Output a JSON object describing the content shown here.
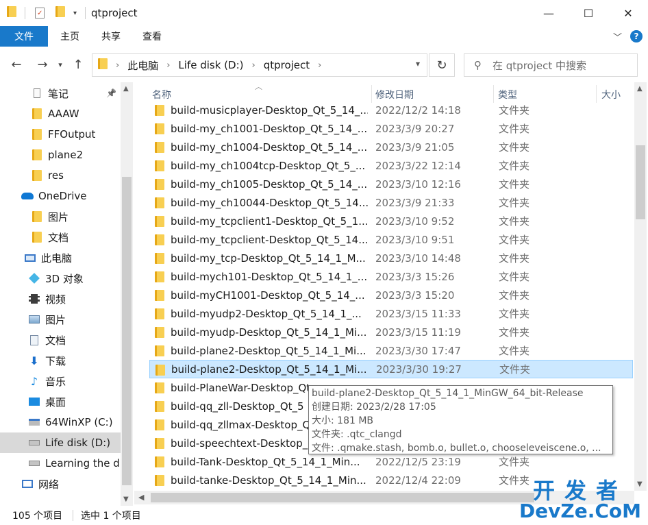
{
  "window": {
    "title": "qtproject",
    "minimize": "—",
    "maximize": "☐",
    "close": "✕"
  },
  "ribbon": {
    "tabs": [
      "文件",
      "主页",
      "共享",
      "查看"
    ]
  },
  "address": {
    "crumbs": [
      "此电脑",
      "Life disk (D:)",
      "qtproject"
    ],
    "search_placeholder": "在 qtproject 中搜索"
  },
  "nav": {
    "items": [
      {
        "label": "笔记",
        "icon": "notes-icon",
        "pinned": true
      },
      {
        "label": "AAAW",
        "icon": "folder-icon"
      },
      {
        "label": "FFOutput",
        "icon": "folder-icon"
      },
      {
        "label": "plane2",
        "icon": "folder-icon"
      },
      {
        "label": "res",
        "icon": "folder-icon"
      },
      {
        "label": "OneDrive",
        "icon": "onedrive-icon"
      },
      {
        "label": "图片",
        "icon": "folder-icon"
      },
      {
        "label": "文档",
        "icon": "folder-icon"
      },
      {
        "label": "此电脑",
        "icon": "computer-icon"
      },
      {
        "label": "3D 对象",
        "icon": "3d-objects-icon"
      },
      {
        "label": "视频",
        "icon": "video-icon"
      },
      {
        "label": "图片",
        "icon": "pictures-icon"
      },
      {
        "label": "文档",
        "icon": "documents-icon"
      },
      {
        "label": "下载",
        "icon": "download-icon"
      },
      {
        "label": "音乐",
        "icon": "music-icon"
      },
      {
        "label": "桌面",
        "icon": "desktop-icon"
      },
      {
        "label": "64WinXP  (C:)",
        "icon": "windows-drive-icon"
      },
      {
        "label": "Life disk (D:)",
        "icon": "drive-icon",
        "selected": true
      },
      {
        "label": "Learning the di",
        "icon": "drive-icon"
      },
      {
        "label": "网络",
        "icon": "network-icon"
      }
    ]
  },
  "columns": {
    "name": "名称",
    "date": "修改日期",
    "type": "类型",
    "size": "大小"
  },
  "files": [
    {
      "name": "build-musicplayer-Desktop_Qt_5_14_...",
      "date": "2022/12/2 14:18",
      "type": "文件夹"
    },
    {
      "name": "build-my_ch1001-Desktop_Qt_5_14_...",
      "date": "2023/3/9 20:27",
      "type": "文件夹"
    },
    {
      "name": "build-my_ch1004-Desktop_Qt_5_14_...",
      "date": "2023/3/9 21:05",
      "type": "文件夹"
    },
    {
      "name": "build-my_ch1004tcp-Desktop_Qt_5_...",
      "date": "2023/3/22 12:14",
      "type": "文件夹"
    },
    {
      "name": "build-my_ch1005-Desktop_Qt_5_14_...",
      "date": "2023/3/10 12:16",
      "type": "文件夹"
    },
    {
      "name": "build-my_ch10044-Desktop_Qt_5_14...",
      "date": "2023/3/9 21:33",
      "type": "文件夹"
    },
    {
      "name": "build-my_tcpclient1-Desktop_Qt_5_1...",
      "date": "2023/3/10 9:52",
      "type": "文件夹"
    },
    {
      "name": "build-my_tcpclient-Desktop_Qt_5_14...",
      "date": "2023/3/10 9:51",
      "type": "文件夹"
    },
    {
      "name": "build-my_tcp-Desktop_Qt_5_14_1_M...",
      "date": "2023/3/10 14:48",
      "type": "文件夹"
    },
    {
      "name": "build-mych101-Desktop_Qt_5_14_1_...",
      "date": "2023/3/3 15:26",
      "type": "文件夹"
    },
    {
      "name": "build-myCH1001-Desktop_Qt_5_14_...",
      "date": "2023/3/3 15:20",
      "type": "文件夹"
    },
    {
      "name": "build-myudp2-Desktop_Qt_5_14_1_...",
      "date": "2023/3/15 11:33",
      "type": "文件夹"
    },
    {
      "name": "build-myudp-Desktop_Qt_5_14_1_Mi...",
      "date": "2023/3/15 11:19",
      "type": "文件夹"
    },
    {
      "name": "build-plane2-Desktop_Qt_5_14_1_Mi...",
      "date": "2023/3/30 17:47",
      "type": "文件夹"
    },
    {
      "name": "build-plane2-Desktop_Qt_5_14_1_Mi...",
      "date": "2023/3/30 19:27",
      "type": "文件夹",
      "selected": true
    },
    {
      "name": "build-PlaneWar-Desktop_Qt",
      "date": "",
      "type": ""
    },
    {
      "name": "build-qq_zll-Desktop_Qt_5",
      "date": "",
      "type": ""
    },
    {
      "name": "build-qq_zllmax-Desktop_Q",
      "date": "",
      "type": ""
    },
    {
      "name": "build-speechtext-Desktop_",
      "date": "",
      "type": ""
    },
    {
      "name": "build-Tank-Desktop_Qt_5_14_1_Min...",
      "date": "2022/12/5 23:19",
      "type": "文件夹"
    },
    {
      "name": "build-tanke-Desktop_Qt_5_14_1_Min...",
      "date": "2022/12/4 22:09",
      "type": "文件夹"
    }
  ],
  "tooltip": {
    "line1": "build-plane2-Desktop_Qt_5_14_1_MinGW_64_bit-Release",
    "line2": "创建日期: 2023/2/28 17:05",
    "line3": "大小: 181 MB",
    "line4": "文件夹: .qtc_clangd",
    "line5": "文件: .qmake.stash, bomb.o, bullet.o, chooseleveiscene.o, ..."
  },
  "status": {
    "count": "105 个项目",
    "selected": "选中 1 个项目"
  },
  "watermark": {
    "line1": "开发者",
    "line2": "DevZe.CoM"
  },
  "colors": {
    "accent": "#1979ca",
    "selection": "#cce8ff",
    "folder": "#f8cf52"
  }
}
